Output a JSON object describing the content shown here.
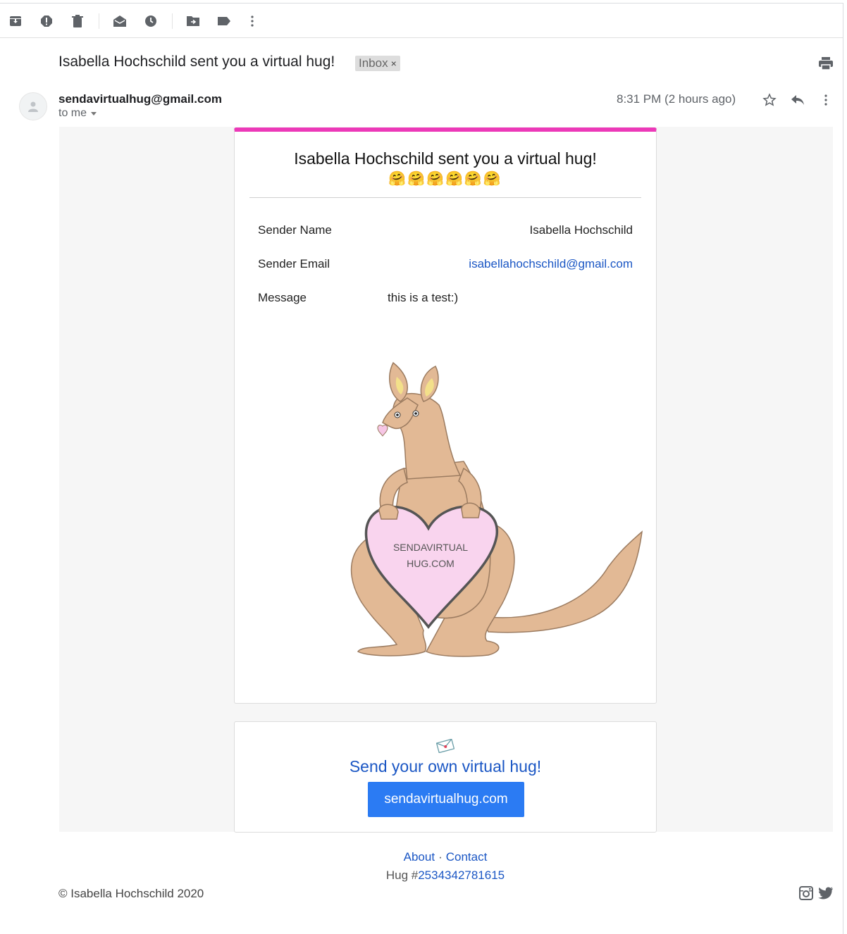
{
  "email": {
    "subject": "Isabella Hochschild sent you a virtual hug!",
    "label": "Inbox",
    "label_remove": "×",
    "sender_email": "sendavirtualhug@gmail.com",
    "recipient": "to me",
    "time": "8:31 PM (2 hours ago)"
  },
  "toolbar": {
    "icons": [
      "archive-icon",
      "report-spam-icon",
      "delete-icon",
      "mark-unread-icon",
      "snooze-icon",
      "move-to-icon",
      "labels-icon",
      "more-icon"
    ]
  },
  "card": {
    "title": "Isabella Hochschild sent you a virtual hug!",
    "emojis": "🤗🤗🤗🤗🤗🤗",
    "rows": [
      {
        "label": "Sender Name",
        "value": "Isabella Hochschild"
      },
      {
        "label": "Sender Email",
        "value": "isabellahochschild@gmail.com"
      },
      {
        "label": "Message",
        "value": "this is a test:)"
      }
    ],
    "heart_text_line1": "SENDAVIRTUAL",
    "heart_text_line2": "HUG.COM"
  },
  "cta": {
    "text": "Send your own virtual hug!",
    "button": "sendavirtualhug.com"
  },
  "footer": {
    "about": "About",
    "separator": "·",
    "contact": "Contact",
    "hug_prefix": "Hug #",
    "hug_number": "2534342781615",
    "copyright": "© Isabella Hochschild 2020"
  },
  "colors": {
    "accent_pink": "#ec39b8",
    "link_blue": "#1a56c4",
    "button_blue": "#2b7bf3"
  }
}
